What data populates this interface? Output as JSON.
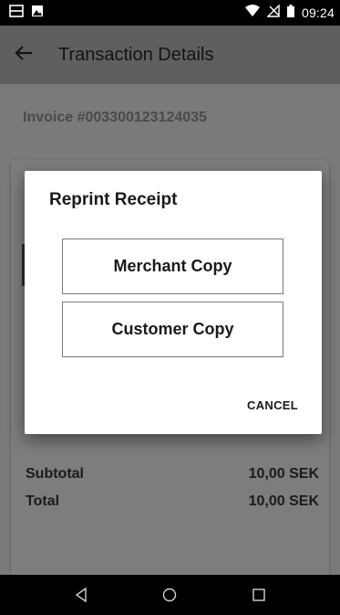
{
  "status_bar": {
    "time": "09:24",
    "icons": [
      "sim-card-icon",
      "image-icon",
      "wifi-icon",
      "no-signal-icon",
      "battery-icon"
    ]
  },
  "app_bar": {
    "back_icon": "arrow-left-icon",
    "title": "Transaction Details"
  },
  "content": {
    "invoice": "Invoice #003300123124035",
    "totals": [
      {
        "label": "Subtotal",
        "value": "10,00 SEK"
      },
      {
        "label": "Total",
        "value": "10,00 SEK"
      }
    ]
  },
  "dialog": {
    "title": "Reprint Receipt",
    "merchant_copy": "Merchant Copy",
    "customer_copy": "Customer Copy",
    "cancel": "CANCEL"
  },
  "nav_bar": {
    "icons": [
      "back-triangle-icon",
      "home-circle-icon",
      "recents-square-icon"
    ]
  }
}
